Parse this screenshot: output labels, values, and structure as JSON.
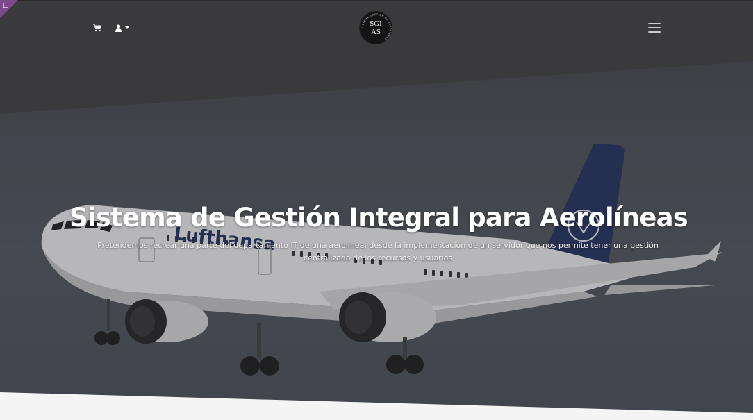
{
  "header": {
    "logo_line1": "SGI",
    "logo_line2": "AS",
    "logo_ring_text": "SISTEMA GESTIÓN DE AEROLÍNEAS",
    "icons": {
      "cart": "shopping-cart-icon",
      "user": "user-icon",
      "menu": "hamburger-menu-icon"
    }
  },
  "hero": {
    "title": "Sistema de Gestión Integral para Aerolíneas",
    "subtitle": "Pretendemos recrear una parte del departamento IT de una aerolínea, desde la implementación de un servidor que nos permite tener una gestión centralizada de los recursos y usuarios",
    "plane_livery_text": "Lufthansa"
  },
  "colors": {
    "navbar": "#3a3a3c",
    "hero_overlay": "#45484f",
    "accent_badge": "#7a4a8a",
    "plane_tail": "#1b2a55"
  }
}
